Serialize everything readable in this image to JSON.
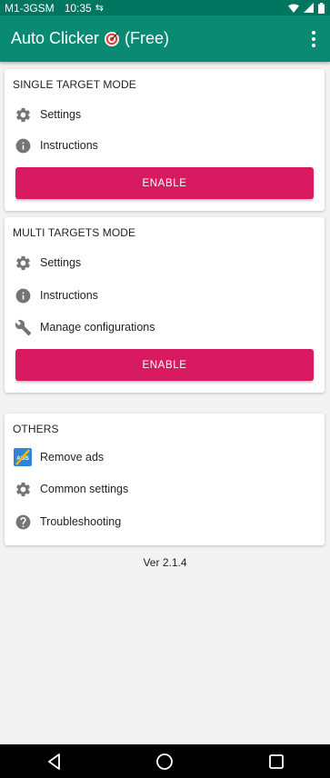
{
  "status_bar": {
    "carrier": "M1-3GSM",
    "time": "10:35",
    "icons": [
      "sync-icon",
      "wifi-icon",
      "signal-icon",
      "battery-icon"
    ]
  },
  "app_bar": {
    "title": "Auto Clicker",
    "title_suffix": "(Free)",
    "title_icon": "target-icon",
    "menu_icon": "more-vert-icon"
  },
  "colors": {
    "status_bar": "#00755f",
    "app_bar": "#0a8a73",
    "accent": "#d81b60",
    "background": "#f3f3f3",
    "card": "#ffffff",
    "icon": "#757575"
  },
  "single_target": {
    "title": "SINGLE TARGET MODE",
    "items": [
      {
        "icon": "gear-icon",
        "label": "Settings"
      },
      {
        "icon": "info-icon",
        "label": "Instructions"
      }
    ],
    "button": "ENABLE"
  },
  "multi_targets": {
    "title": "MULTI TARGETS MODE",
    "items": [
      {
        "icon": "gear-icon",
        "label": "Settings"
      },
      {
        "icon": "info-icon",
        "label": "Instructions"
      },
      {
        "icon": "wrench-icon",
        "label": "Manage configurations"
      }
    ],
    "button": "ENABLE"
  },
  "others": {
    "title": "OTHERS",
    "items": [
      {
        "icon": "ads-icon",
        "label": "Remove ads"
      },
      {
        "icon": "gear-icon",
        "label": "Common settings"
      },
      {
        "icon": "help-icon",
        "label": "Troubleshooting"
      }
    ]
  },
  "version": "Ver 2.1.4",
  "nav_bar": {
    "icons": [
      "back-icon",
      "home-icon",
      "recents-icon"
    ]
  }
}
